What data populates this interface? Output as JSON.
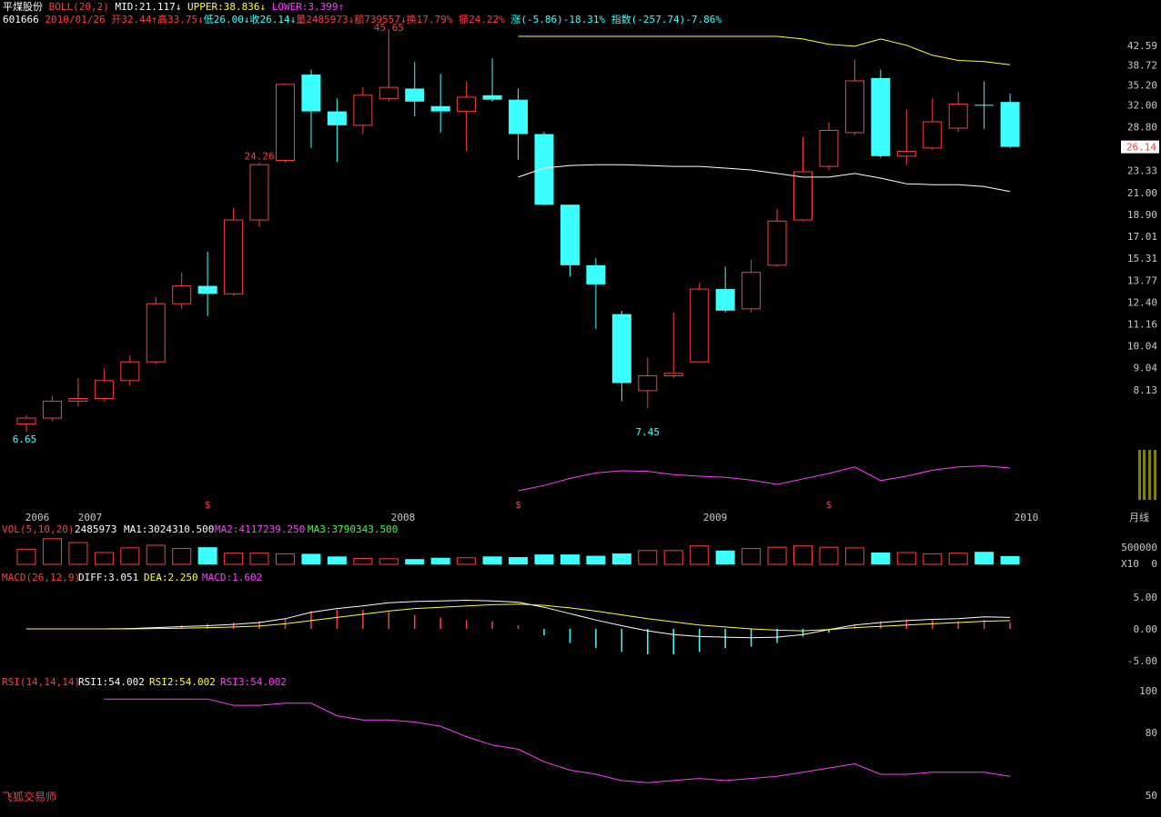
{
  "header": {
    "stock_name": "平煤股份",
    "boll_label": "BOLL(20,2)",
    "mid": "MID:21.117",
    "upper": "UPPER:38.836",
    "lower": "LOWER:3.399",
    "code": "601666",
    "date": "2010/01/26",
    "open": "开32.44",
    "high": "高33.75",
    "low": "低26.00",
    "close": "收26.14",
    "volume": "量2485973",
    "amount": "额739557",
    "turnover": "换17.79%",
    "amplitude": "振24.22%",
    "change": "涨(-5.86)-18.31%",
    "index": "指数(-257.74)-7.86%"
  },
  "price_axis_labels": [
    "42.59",
    "38.72",
    "35.20",
    "32.00",
    "28.80",
    "26.14",
    "23.33",
    "21.00",
    "18.90",
    "17.01",
    "15.31",
    "13.77",
    "12.40",
    "11.16",
    "10.04",
    "9.04",
    "8.13"
  ],
  "annotations": {
    "max": "45.65",
    "min": "6.65",
    "min2": "7.45",
    "mark": "24.26"
  },
  "years": [
    "2006",
    "2007",
    "2008",
    "2009",
    "2010"
  ],
  "period_label": "月线",
  "vol_header": {
    "label": "VOL(5,10,20)",
    "value": "2485973",
    "ma1": "MA1:3024310.500",
    "ma2": "MA2:4117239.250",
    "ma3": "MA3:3790343.500"
  },
  "vol_axis": {
    "top": "500000",
    "unit": "X10",
    "zero": "0"
  },
  "macd_header": {
    "label": "MACD(26,12,9)",
    "diff": "DIFF:3.051",
    "dea": "DEA:2.250",
    "macd": "MACD:1.602"
  },
  "macd_axis": [
    "5.00",
    "0.00",
    "-5.00"
  ],
  "rsi_header": {
    "label": "RSI(14,14,14)",
    "rsi1": "RSI1:54.002",
    "rsi2": "RSI2:54.002",
    "rsi3": "RSI3:54.002"
  },
  "rsi_axis": [
    "100",
    "80",
    "50"
  ],
  "brand": "飞狐交易师",
  "current_price": "26.14",
  "chart_data": {
    "type": "candlestick",
    "candles": [
      {
        "o": 6.9,
        "h": 7.2,
        "l": 6.65,
        "c": 7.1
      },
      {
        "o": 7.1,
        "h": 7.9,
        "l": 7.0,
        "c": 7.7
      },
      {
        "o": 7.7,
        "h": 8.6,
        "l": 7.5,
        "c": 7.8
      },
      {
        "o": 7.8,
        "h": 9.0,
        "l": 7.7,
        "c": 8.5
      },
      {
        "o": 8.5,
        "h": 9.6,
        "l": 8.3,
        "c": 9.3
      },
      {
        "o": 9.3,
        "h": 12.7,
        "l": 9.2,
        "c": 12.3
      },
      {
        "o": 12.3,
        "h": 14.3,
        "l": 12.0,
        "c": 13.4
      },
      {
        "o": 13.4,
        "h": 15.8,
        "l": 11.6,
        "c": 12.9
      },
      {
        "o": 12.9,
        "h": 19.5,
        "l": 12.8,
        "c": 18.4
      },
      {
        "o": 18.4,
        "h": 24.26,
        "l": 17.8,
        "c": 24.0
      },
      {
        "o": 24.5,
        "h": 35.5,
        "l": 24.3,
        "c": 35.3
      },
      {
        "o": 37.0,
        "h": 37.9,
        "l": 26.0,
        "c": 31.0
      },
      {
        "o": 31.0,
        "h": 33.0,
        "l": 24.3,
        "c": 29.0
      },
      {
        "o": 29.0,
        "h": 34.8,
        "l": 27.8,
        "c": 33.5
      },
      {
        "o": 33.0,
        "h": 45.65,
        "l": 32.5,
        "c": 34.8
      },
      {
        "o": 34.6,
        "h": 39.3,
        "l": 30.3,
        "c": 32.5
      },
      {
        "o": 31.8,
        "h": 37.1,
        "l": 28.0,
        "c": 31.0
      },
      {
        "o": 31.0,
        "h": 35.8,
        "l": 25.6,
        "c": 33.2
      },
      {
        "o": 33.5,
        "h": 40.0,
        "l": 32.5,
        "c": 32.8
      },
      {
        "o": 32.8,
        "h": 34.6,
        "l": 24.6,
        "c": 27.8
      },
      {
        "o": 27.8,
        "h": 28.1,
        "l": 19.7,
        "c": 19.8
      },
      {
        "o": 19.8,
        "h": 19.8,
        "l": 14.0,
        "c": 14.8
      },
      {
        "o": 14.8,
        "h": 15.3,
        "l": 10.9,
        "c": 13.5
      },
      {
        "o": 11.7,
        "h": 11.9,
        "l": 7.7,
        "c": 8.4
      },
      {
        "o": 8.1,
        "h": 9.5,
        "l": 7.45,
        "c": 8.7
      },
      {
        "o": 8.7,
        "h": 11.8,
        "l": 8.6,
        "c": 8.8
      },
      {
        "o": 9.3,
        "h": 13.6,
        "l": 9.3,
        "c": 13.2
      },
      {
        "o": 13.2,
        "h": 14.7,
        "l": 11.8,
        "c": 11.9
      },
      {
        "o": 12.0,
        "h": 15.2,
        "l": 11.8,
        "c": 14.3
      },
      {
        "o": 14.8,
        "h": 19.4,
        "l": 14.7,
        "c": 18.3
      },
      {
        "o": 18.4,
        "h": 27.4,
        "l": 18.3,
        "c": 23.2
      },
      {
        "o": 23.8,
        "h": 29.4,
        "l": 23.4,
        "c": 28.3
      },
      {
        "o": 28.0,
        "h": 39.8,
        "l": 27.7,
        "c": 35.9
      },
      {
        "o": 36.4,
        "h": 37.9,
        "l": 24.8,
        "c": 25.0
      },
      {
        "o": 25.0,
        "h": 31.3,
        "l": 24.0,
        "c": 25.6
      },
      {
        "o": 26.0,
        "h": 33.0,
        "l": 25.8,
        "c": 29.5
      },
      {
        "o": 28.6,
        "h": 34.0,
        "l": 28.1,
        "c": 32.1
      },
      {
        "o": 32.0,
        "h": 35.8,
        "l": 28.5,
        "c": 31.9
      },
      {
        "o": 32.44,
        "h": 33.75,
        "l": 26.0,
        "c": 26.14
      }
    ],
    "boll_upper": [
      null,
      null,
      null,
      null,
      null,
      null,
      null,
      null,
      null,
      null,
      null,
      null,
      null,
      null,
      null,
      null,
      null,
      null,
      null,
      47.5,
      47.0,
      46.3,
      45.5,
      45.1,
      45.1,
      45.4,
      45.6,
      45.6,
      45.6,
      45.7,
      43.9,
      42.8,
      42.4,
      43.9,
      42.6,
      40.6,
      39.6,
      39.4,
      38.8
    ],
    "boll_mid": [
      null,
      null,
      null,
      null,
      null,
      null,
      null,
      null,
      null,
      null,
      null,
      null,
      null,
      null,
      null,
      null,
      null,
      null,
      null,
      22.6,
      23.6,
      23.9,
      24.0,
      24.0,
      23.9,
      23.8,
      23.8,
      23.6,
      23.4,
      23.0,
      22.6,
      22.6,
      23.0,
      22.5,
      21.9,
      21.8,
      21.8,
      21.6,
      21.1
    ],
    "boll_lower": [
      null,
      null,
      null,
      null,
      null,
      null,
      null,
      null,
      null,
      null,
      null,
      null,
      null,
      null,
      null,
      null,
      null,
      null,
      null,
      -2.2,
      0.2,
      1.5,
      2.5,
      2.9,
      2.8,
      2.2,
      1.9,
      1.7,
      1.2,
      0.4,
      1.4,
      2.4,
      3.6,
      1.1,
      1.9,
      3.0,
      3.6,
      3.8,
      3.4
    ],
    "volume": [
      460,
      780,
      660,
      360,
      500,
      580,
      480,
      520,
      340,
      340,
      320,
      320,
      240,
      180,
      170,
      160,
      200,
      200,
      240,
      220,
      300,
      300,
      260,
      330,
      420,
      420,
      560,
      420,
      480,
      520,
      560,
      520,
      500,
      360,
      360,
      320,
      340,
      380,
      250
    ],
    "vol_up": [
      true,
      true,
      true,
      true,
      true,
      true,
      true,
      false,
      true,
      true,
      true,
      false,
      false,
      true,
      true,
      false,
      false,
      true,
      false,
      false,
      false,
      false,
      false,
      false,
      true,
      true,
      true,
      false,
      true,
      true,
      true,
      true,
      true,
      false,
      true,
      true,
      true,
      false,
      false
    ],
    "macd_diff": [
      0,
      0,
      0,
      0,
      0.05,
      0.2,
      0.35,
      0.5,
      0.7,
      1.0,
      1.6,
      2.6,
      3.2,
      3.6,
      4.1,
      4.3,
      4.4,
      4.5,
      4.4,
      4.2,
      3.4,
      2.4,
      1.4,
      0.5,
      -0.3,
      -0.9,
      -1.2,
      -1.3,
      -1.4,
      -1.3,
      -0.9,
      -0.1,
      0.6,
      1.0,
      1.3,
      1.5,
      1.6,
      1.9,
      1.8
    ],
    "macd_dea": [
      0,
      0,
      0,
      0,
      0,
      0.05,
      0.1,
      0.2,
      0.3,
      0.45,
      0.8,
      1.3,
      1.8,
      2.3,
      2.8,
      3.2,
      3.4,
      3.6,
      3.8,
      3.9,
      3.7,
      3.3,
      2.8,
      2.2,
      1.6,
      1.1,
      0.6,
      0.3,
      0,
      -0.2,
      -0.3,
      -0.1,
      0.2,
      0.4,
      0.6,
      0.8,
      1.0,
      1.2,
      1.3
    ],
    "macd_bar": [
      0,
      0,
      0,
      0,
      0.1,
      0.3,
      0.6,
      0.8,
      1.0,
      1.2,
      1.6,
      2.8,
      3.0,
      3.0,
      2.6,
      2.2,
      1.8,
      1.4,
      1.2,
      0.6,
      -1.0,
      -2.2,
      -3.0,
      -3.6,
      -4.0,
      -4.0,
      -3.6,
      -3.0,
      -2.8,
      -2.2,
      -1.2,
      -0.6,
      0.6,
      1.2,
      1.4,
      1.4,
      1.2,
      1.4,
      1.0
    ],
    "rsi": [
      null,
      null,
      null,
      96,
      96,
      96,
      96,
      96,
      93,
      93,
      94,
      94,
      88,
      86,
      86,
      85,
      83,
      78,
      74,
      72,
      66,
      62,
      60,
      57,
      56,
      57,
      58,
      57,
      58,
      59,
      61,
      63,
      65,
      60,
      60,
      61,
      61,
      61,
      59
    ]
  }
}
